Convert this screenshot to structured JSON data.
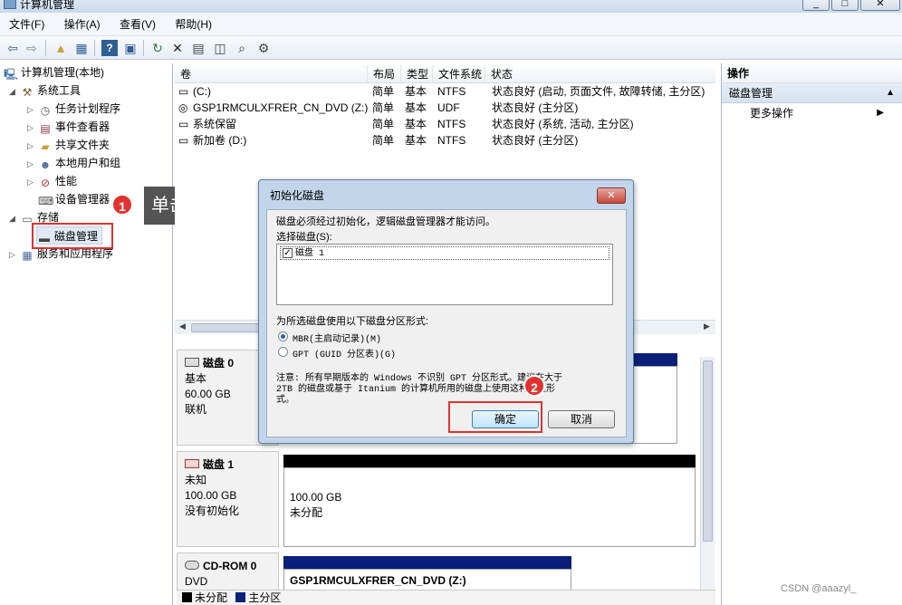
{
  "window": {
    "title": "计算机管理",
    "controls": [
      "_",
      "□",
      "✕"
    ]
  },
  "menubar": [
    {
      "label": "文件(F)"
    },
    {
      "label": "操作(A)"
    },
    {
      "label": "查看(V)"
    },
    {
      "label": "帮助(H)"
    }
  ],
  "toolbar": {
    "icons": [
      "back-arrow-icon",
      "forward-arrow-icon",
      "up-folder-icon",
      "show-hide-tree-icon",
      "help-icon",
      "show-hide-action-pane-icon",
      "refresh-icon",
      "delete-icon",
      "properties-icon",
      "rescan-icon",
      "export-icon"
    ]
  },
  "tree": {
    "root": "计算机管理(本地)",
    "system_tools": "系统工具",
    "task_scheduler": "任务计划程序",
    "event_viewer": "事件查看器",
    "shared_folders": "共享文件夹",
    "local_users": "本地用户和组",
    "performance": "性能",
    "device_manager": "设备管理器",
    "storage": "存储",
    "disk_management": "磁盘管理",
    "services_apps": "服务和应用程序"
  },
  "annotations": {
    "step1_number": "1",
    "step1_text": "单击",
    "step2_number": "2"
  },
  "volumes": {
    "columns": [
      "卷",
      "布局",
      "类型",
      "文件系统",
      "状态"
    ],
    "rows": [
      {
        "volume": "(C:)",
        "layout": "简单",
        "type": "基本",
        "fs": "NTFS",
        "status": "状态良好 (启动, 页面文件, 故障转储, 主分区)"
      },
      {
        "volume": "GSP1RMCULXFRER_CN_DVD (Z:)",
        "layout": "简单",
        "type": "基本",
        "fs": "UDF",
        "status": "状态良好 (主分区)"
      },
      {
        "volume": "系统保留",
        "layout": "简单",
        "type": "基本",
        "fs": "NTFS",
        "status": "状态良好 (系统, 活动, 主分区)"
      },
      {
        "volume": "新加卷 (D:)",
        "layout": "简单",
        "type": "基本",
        "fs": "NTFS",
        "status": "状态良好 (主分区)"
      }
    ]
  },
  "disks": [
    {
      "name": "磁盘 0",
      "kind": "基本",
      "size": "60.00 GB",
      "state": "联机"
    },
    {
      "name": "磁盘 1",
      "kind": "未知",
      "size": "100.00 GB",
      "state": "没有初始化",
      "partition_size": "100.00 GB",
      "partition_state": "未分配"
    },
    {
      "name": "CD-ROM 0",
      "kind": "DVD",
      "partition_label": "GSP1RMCULXFRER_CN_DVD  (Z:)"
    }
  ],
  "legend": {
    "unallocated": "未分配",
    "primary": "主分区"
  },
  "colors": {
    "unallocated": "#000000",
    "primary": "#0a1f7a",
    "highlight": "#e1322f"
  },
  "actions": {
    "header": "操作",
    "section": "磁盘管理",
    "more": "更多操作"
  },
  "dialog": {
    "title": "初始化磁盘",
    "intro": "磁盘必须经过初始化，逻辑磁盘管理器才能访问。",
    "select_label": "选择磁盘(S):",
    "disk_item": "磁盘 1",
    "partition_prompt": "为所选磁盘使用以下磁盘分区形式:",
    "mbr_label": "MBR(主启动记录)(M)",
    "gpt_label": "GPT (GUID 分区表)(G)",
    "note_line1": "注意: 所有早期版本的 Windows 不识别 GPT 分区形式。建议在大于",
    "note_line2": "2TB 的磁盘或基于 Itanium 的计算机所用的磁盘上使用这种分区形",
    "note_line3": "式。",
    "ok_label": "确定",
    "cancel_label": "取消"
  },
  "watermark": "CSDN @aaazyl_"
}
